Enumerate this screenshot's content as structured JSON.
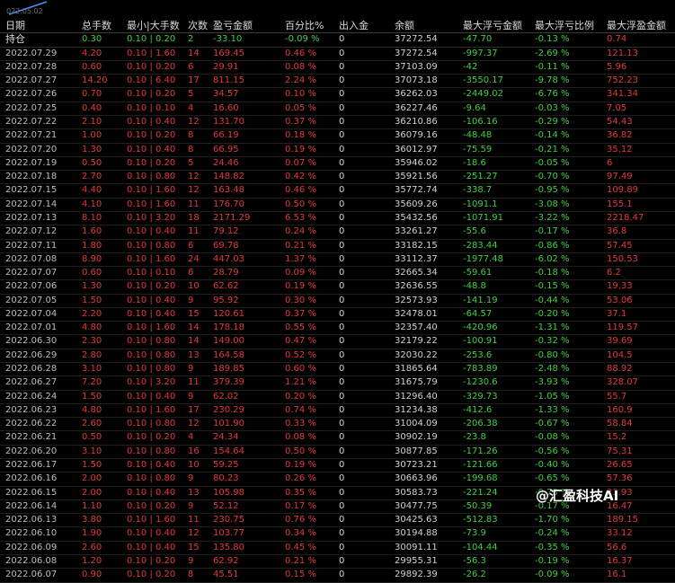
{
  "top_date": "022.05.02",
  "watermark": "@汇盈科技AI",
  "headers": [
    "日期",
    "总手数",
    "最小|大手数",
    "次数",
    "盈亏金额",
    "百分比%",
    "出入金",
    "余额",
    "最大浮亏金额",
    "最大浮亏比例",
    "最大浮盈金额"
  ],
  "summary": [
    "持仓",
    "0.30",
    "0.10 | 0.20",
    "2",
    "-33.10",
    "-0.09 %",
    "0",
    "37272.54",
    "-47.70",
    "-0.13 %",
    "0.74"
  ],
  "rows": [
    [
      "2022.07.29",
      "4.20",
      "0.10 | 1.60",
      "14",
      "169.45",
      "0.46 %",
      "0",
      "37272.54",
      "-997.37",
      "-2.69 %",
      "121.13"
    ],
    [
      "2022.07.28",
      "0.60",
      "0.10 | 0.20",
      "6",
      "29.91",
      "0.08 %",
      "0",
      "37103.09",
      "-42",
      "-0.11 %",
      "5.96"
    ],
    [
      "2022.07.27",
      "14.20",
      "0.10 | 6.40",
      "17",
      "811.15",
      "2.24 %",
      "0",
      "37073.18",
      "-3550.17",
      "-9.78 %",
      "752.23"
    ],
    [
      "2022.07.26",
      "0.70",
      "0.10 | 0.20",
      "5",
      "34.57",
      "0.10 %",
      "0",
      "36262.03",
      "-2449.02",
      "-6.76 %",
      "341.34"
    ],
    [
      "2022.07.25",
      "0.40",
      "0.10 | 0.10",
      "4",
      "16.60",
      "0.05 %",
      "0",
      "36227.46",
      "-9.64",
      "-0.03 %",
      "7.05"
    ],
    [
      "2022.07.22",
      "2.10",
      "0.10 | 0.40",
      "12",
      "131.70",
      "0.37 %",
      "0",
      "36210.86",
      "-106.16",
      "-0.29 %",
      "54.43"
    ],
    [
      "2022.07.21",
      "1.00",
      "0.10 | 0.20",
      "8",
      "66.19",
      "0.18 %",
      "0",
      "36079.16",
      "-48.48",
      "-0.14 %",
      "36.82"
    ],
    [
      "2022.07.20",
      "1.30",
      "0.10 | 0.40",
      "8",
      "66.95",
      "0.19 %",
      "0",
      "36012.97",
      "-75.59",
      "-0.21 %",
      "35.12"
    ],
    [
      "2022.07.19",
      "0.50",
      "0.10 | 0.20",
      "5",
      "24.46",
      "0.07 %",
      "0",
      "35946.02",
      "-18.6",
      "-0.05 %",
      "6"
    ],
    [
      "2022.07.18",
      "2.70",
      "0.10 | 0.80",
      "12",
      "148.82",
      "0.42 %",
      "0",
      "35921.56",
      "-251.27",
      "-0.70 %",
      "97.49"
    ],
    [
      "2022.07.15",
      "4.40",
      "0.10 | 1.60",
      "12",
      "163.48",
      "0.46 %",
      "0",
      "35772.74",
      "-338.7",
      "-0.95 %",
      "109.89"
    ],
    [
      "2022.07.14",
      "4.10",
      "0.10 | 1.60",
      "11",
      "176.70",
      "0.50 %",
      "0",
      "35609.26",
      "-1091.1",
      "-3.08 %",
      "155.1"
    ],
    [
      "2022.07.13",
      "8.10",
      "0.10 | 3.20",
      "18",
      "2171.29",
      "6.53 %",
      "0",
      "35432.56",
      "-1071.91",
      "-3.22 %",
      "2218.47"
    ],
    [
      "2022.07.12",
      "1.60",
      "0.10 | 0.40",
      "11",
      "79.12",
      "0.24 %",
      "0",
      "33261.27",
      "-55.6",
      "-0.17 %",
      "36.8"
    ],
    [
      "2022.07.11",
      "1.80",
      "0.10 | 0.80",
      "6",
      "69.78",
      "0.21 %",
      "0",
      "33182.15",
      "-283.44",
      "-0.86 %",
      "57.45"
    ],
    [
      "2022.07.08",
      "8.90",
      "0.10 | 1.60",
      "24",
      "447.03",
      "1.37 %",
      "0",
      "33112.37",
      "-1977.48",
      "-6.02 %",
      "150.53"
    ],
    [
      "2022.07.07",
      "0.60",
      "0.10 | 0.10",
      "6",
      "28.79",
      "0.09 %",
      "0",
      "32665.34",
      "-59.61",
      "-0.18 %",
      "6.2"
    ],
    [
      "2022.07.06",
      "1.30",
      "0.10 | 0.20",
      "10",
      "62.62",
      "0.19 %",
      "0",
      "32636.55",
      "-48.8",
      "-0.15 %",
      "19.33"
    ],
    [
      "2022.07.05",
      "1.50",
      "0.10 | 0.40",
      "9",
      "95.92",
      "0.30 %",
      "0",
      "32573.93",
      "-141.19",
      "-0.44 %",
      "53.06"
    ],
    [
      "2022.07.04",
      "2.20",
      "0.10 | 0.40",
      "15",
      "120.61",
      "0.37 %",
      "0",
      "32478.01",
      "-64.57",
      "-0.20 %",
      "37.1"
    ],
    [
      "2022.07.01",
      "4.80",
      "0.10 | 1.60",
      "14",
      "178.18",
      "0.55 %",
      "0",
      "32357.40",
      "-420.96",
      "-1.31 %",
      "119.57"
    ],
    [
      "2022.06.30",
      "2.30",
      "0.10 | 0.80",
      "14",
      "149.00",
      "0.47 %",
      "0",
      "32179.22",
      "-100.91",
      "-0.32 %",
      "39.69"
    ],
    [
      "2022.06.29",
      "2.80",
      "0.10 | 0.80",
      "13",
      "164.58",
      "0.52 %",
      "0",
      "32030.22",
      "-253.6",
      "-0.80 %",
      "104.5"
    ],
    [
      "2022.06.28",
      "3.10",
      "0.10 | 0.80",
      "9",
      "189.85",
      "0.60 %",
      "0",
      "31865.64",
      "-783.89",
      "-2.48 %",
      "88.92"
    ],
    [
      "2022.06.27",
      "7.20",
      "0.10 | 3.20",
      "11",
      "379.39",
      "1.21 %",
      "0",
      "31675.79",
      "-1230.6",
      "-3.93 %",
      "328.07"
    ],
    [
      "2022.06.24",
      "1.50",
      "0.10 | 0.40",
      "9",
      "62.02",
      "0.20 %",
      "0",
      "31296.40",
      "-329.73",
      "-1.05 %",
      "55.7"
    ],
    [
      "2022.06.23",
      "4.80",
      "0.10 | 1.60",
      "17",
      "230.29",
      "0.74 %",
      "0",
      "31234.38",
      "-412.6",
      "-1.33 %",
      "160.9"
    ],
    [
      "2022.06.22",
      "2.60",
      "0.10 | 0.80",
      "12",
      "101.90",
      "0.33 %",
      "0",
      "31004.09",
      "-206.38",
      "-0.67 %",
      "58.84"
    ],
    [
      "2022.06.21",
      "0.50",
      "0.10 | 0.20",
      "4",
      "24.34",
      "0.08 %",
      "0",
      "30902.19",
      "-23.8",
      "-0.08 %",
      "15.2"
    ],
    [
      "2022.06.20",
      "3.10",
      "0.10 | 0.80",
      "16",
      "154.64",
      "0.50 %",
      "0",
      "30877.85",
      "-171.26",
      "-0.56 %",
      "75.31"
    ],
    [
      "2022.06.17",
      "1.50",
      "0.10 | 0.40",
      "10",
      "59.25",
      "0.19 %",
      "0",
      "30723.21",
      "-121.66",
      "-0.40 %",
      "26.65"
    ],
    [
      "2022.06.16",
      "2.00",
      "0.10 | 0.80",
      "9",
      "80.23",
      "0.26 %",
      "0",
      "30663.96",
      "-199.68",
      "-0.65 %",
      "57.36"
    ],
    [
      "2022.06.15",
      "2.00",
      "0.10 | 0.40",
      "13",
      "105.98",
      "0.35 %",
      "0",
      "30583.73",
      "-221.24",
      "-0.73 %",
      "23.93"
    ],
    [
      "2022.06.14",
      "1.10",
      "0.10 | 0.20",
      "9",
      "52.12",
      "0.17 %",
      "0",
      "30477.75",
      "-50.39",
      "-0.17 %",
      "16.47"
    ],
    [
      "2022.06.13",
      "3.80",
      "0.10 | 1.60",
      "11",
      "230.75",
      "0.76 %",
      "0",
      "30425.63",
      "-512.83",
      "-1.70 %",
      "189.15"
    ],
    [
      "2022.06.10",
      "1.90",
      "0.10 | 0.40",
      "12",
      "103.77",
      "0.34 %",
      "0",
      "30194.88",
      "-73.9",
      "-0.24 %",
      "33.12"
    ],
    [
      "2022.06.09",
      "2.60",
      "0.10 | 0.40",
      "15",
      "135.80",
      "0.45 %",
      "0",
      "30091.11",
      "-104.44",
      "-0.35 %",
      "56.6"
    ],
    [
      "2022.06.08",
      "1.20",
      "0.10 | 0.20",
      "9",
      "62.92",
      "0.21 %",
      "0",
      "29955.31",
      "-56.3",
      "-0.19 %",
      "16.37"
    ],
    [
      "2022.06.07",
      "0.90",
      "0.10 | 0.20",
      "8",
      "45.51",
      "0.15 %",
      "0",
      "29892.39",
      "-26.2",
      "-0.09 %",
      "16.1"
    ]
  ],
  "colors": {
    "red": "#e23a3a",
    "green": "#3fd23f",
    "background": "#000000"
  }
}
